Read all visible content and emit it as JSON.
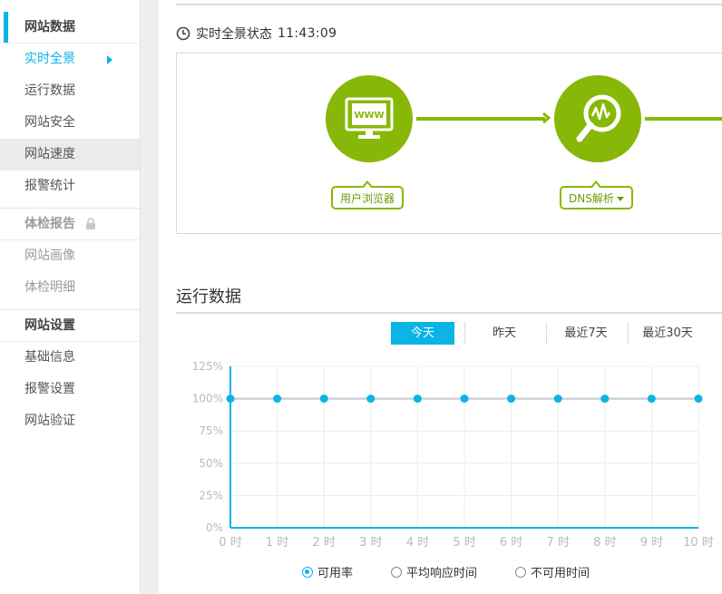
{
  "sidebar": {
    "groups": [
      {
        "title": "网站数据",
        "items": [
          "实时全景",
          "运行数据",
          "网站安全",
          "网站速度",
          "报警统计"
        ]
      },
      {
        "title": "体检报告",
        "items": [
          "网站画像",
          "体检明细"
        ]
      },
      {
        "title": "网站设置",
        "items": [
          "基础信息",
          "报警设置",
          "网站验证"
        ]
      }
    ]
  },
  "status": {
    "label": "实时全景状态",
    "time": "11:43:09"
  },
  "flow": {
    "node1": {
      "icon_text": "WWW",
      "label": "用户浏览器"
    },
    "node2": {
      "label": "DNS解析"
    }
  },
  "section": {
    "title": "运行数据"
  },
  "tabs": [
    "今天",
    "昨天",
    "最近7天",
    "最近30天"
  ],
  "legend": [
    "可用率",
    "平均响应时间",
    "不可用时间"
  ],
  "colors": {
    "accent": "#0bb4e6",
    "green": "#88b807"
  },
  "chart_data": {
    "type": "line",
    "x": [
      "0 时",
      "1 时",
      "2 时",
      "3 时",
      "4 时",
      "5 时",
      "6 时",
      "7 时",
      "8 时",
      "9 时",
      "10 时"
    ],
    "y_ticks": [
      "125%",
      "100%",
      "75%",
      "50%",
      "25%",
      "0%"
    ],
    "ylim": [
      0,
      125
    ],
    "series": [
      {
        "name": "可用率",
        "values": [
          100,
          100,
          100,
          100,
          100,
          100,
          100,
          100,
          100,
          100,
          100
        ]
      }
    ]
  }
}
